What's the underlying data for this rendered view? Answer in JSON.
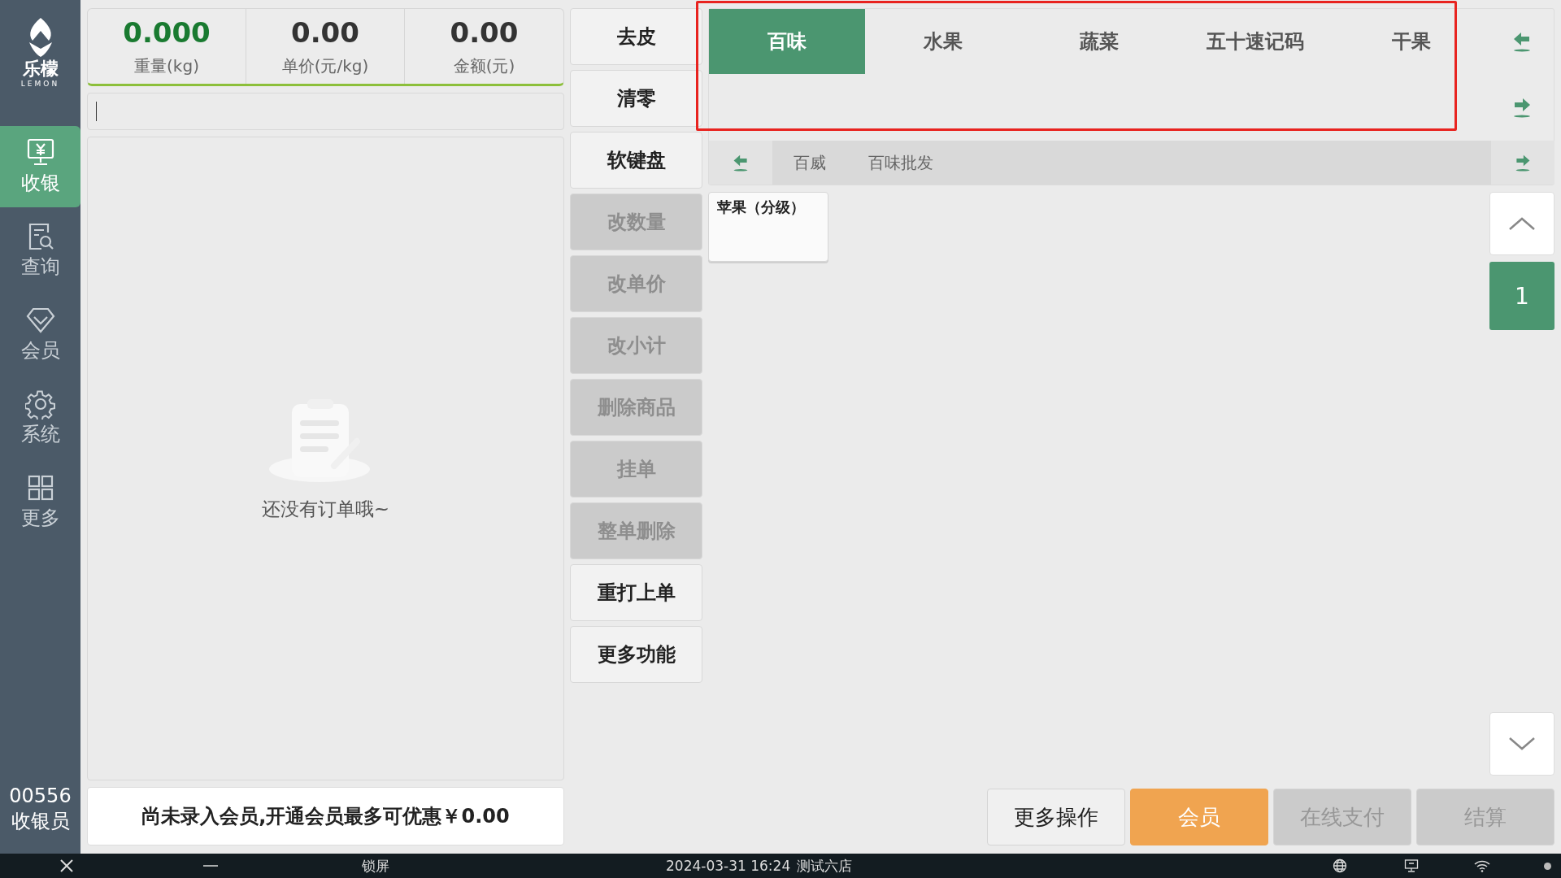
{
  "sidebar": {
    "logo": {
      "name": "乐檬",
      "subtitle": "LEMON"
    },
    "items": [
      {
        "label": "收银",
        "kind": "register",
        "selected": true
      },
      {
        "label": "查询",
        "kind": "query",
        "selected": false
      },
      {
        "label": "会员",
        "kind": "member",
        "selected": false
      },
      {
        "label": "系统",
        "kind": "system",
        "selected": false
      },
      {
        "label": "更多",
        "kind": "more",
        "selected": false
      }
    ],
    "operator": {
      "id": "00556",
      "role": "收银员"
    }
  },
  "scale": {
    "readings": [
      {
        "value": "0.000",
        "label": "重量(kg)",
        "kind": "weight"
      },
      {
        "value": "0.00",
        "label": "单价(元/kg)",
        "kind": "price"
      },
      {
        "value": "0.00",
        "label": "金额(元)",
        "kind": "amount"
      }
    ]
  },
  "order_list": {
    "empty_message": "还没有订单哦~"
  },
  "member_banner": "尚未录入会员,开通会员最多可优惠￥0.00",
  "actions": [
    {
      "label": "去皮",
      "disabled": false
    },
    {
      "label": "清零",
      "disabled": false
    },
    {
      "label": "软键盘",
      "disabled": false
    },
    {
      "label": "改数量",
      "disabled": true
    },
    {
      "label": "改单价",
      "disabled": true
    },
    {
      "label": "改小计",
      "disabled": true
    },
    {
      "label": "删除商品",
      "disabled": true
    },
    {
      "label": "挂单",
      "disabled": true
    },
    {
      "label": "整单删除",
      "disabled": true
    },
    {
      "label": "重打上单",
      "disabled": false
    },
    {
      "label": "更多功能",
      "disabled": false
    }
  ],
  "categories": [
    {
      "label": "百味",
      "selected": true
    },
    {
      "label": "水果",
      "selected": false
    },
    {
      "label": "蔬菜",
      "selected": false
    },
    {
      "label": "五十速记码",
      "selected": false
    },
    {
      "label": "干果",
      "selected": false
    }
  ],
  "subcategories": [
    {
      "label": "百威"
    },
    {
      "label": "百味批发"
    }
  ],
  "products": [
    {
      "name": "苹果（分级）"
    }
  ],
  "pager": {
    "page": "1"
  },
  "checkout_buttons": [
    {
      "label": "更多操作",
      "kind": "default"
    },
    {
      "label": "会员",
      "kind": "primary"
    },
    {
      "label": "在线支付",
      "kind": "disabled"
    },
    {
      "label": "结算",
      "kind": "disabled"
    }
  ],
  "taskbar": {
    "lock": "锁屏",
    "datetime": "2024-03-31 16:24",
    "store": "测试六店"
  }
}
